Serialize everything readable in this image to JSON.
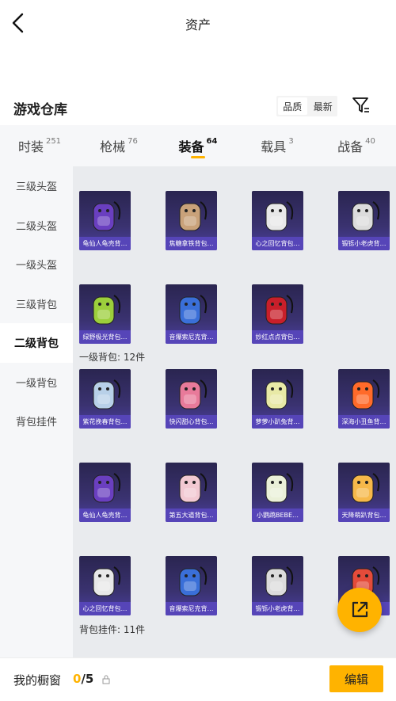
{
  "header": {
    "title": "资产"
  },
  "warehouse": {
    "title": "游戏仓库",
    "sort_options": [
      "品质",
      "最新"
    ],
    "active_sort": 0
  },
  "tabs": [
    {
      "label": "时装",
      "count": "251"
    },
    {
      "label": "枪械",
      "count": "76"
    },
    {
      "label": "装备",
      "count": "64",
      "active": true
    },
    {
      "label": "载具",
      "count": "3"
    },
    {
      "label": "战备",
      "count": "40"
    }
  ],
  "sidebar": {
    "items": [
      "三级头盔",
      "二级头盔",
      "一级头盔",
      "三级背包",
      "二级背包",
      "一级背包",
      "背包挂件"
    ],
    "active_index": 4
  },
  "sections": {
    "level1_backpack": "一级背包: 12件",
    "backpack_pendant": "背包挂件: 11件"
  },
  "items": [
    {
      "label": "龟仙人龟壳背…",
      "color": "#6a3fc0"
    },
    {
      "label": "焦糖拿铁背包…",
      "color": "#c9a27a"
    },
    {
      "label": "心之回忆背包…",
      "color": "#e8e8e8"
    },
    {
      "label": "锻铄小老虎背…",
      "color": "#dcdcdc"
    },
    {
      "label": "绿野极光背包…",
      "color": "#9ccf3c"
    },
    {
      "label": "音爆索尼克背…",
      "color": "#3a6fd8"
    },
    {
      "label": "妙红点点背包…",
      "color": "#c81f2a"
    },
    {
      "label": "紫花挽春背包…",
      "color": "#b8d0e8"
    },
    {
      "label": "快闪甜心背包…",
      "color": "#e87a9a"
    },
    {
      "label": "萝萝小趴兔背…",
      "color": "#e8e9a6"
    },
    {
      "label": "深海小丑鱼背…",
      "color": "#ff6a2a"
    },
    {
      "label": "龟仙人龟壳背…",
      "color": "#6a3fc0"
    },
    {
      "label": "第五大道背包…",
      "color": "#f2c9d2"
    },
    {
      "label": "小鹦鹉BEBE…",
      "color": "#eaf0d8"
    },
    {
      "label": "天降萌趴背包…",
      "color": "#f6b84a"
    },
    {
      "label": "心之回忆背包…",
      "color": "#e8e8e8"
    },
    {
      "label": "音爆索尼克背…",
      "color": "#3a6fd8"
    },
    {
      "label": "锻铄小老虎背…",
      "color": "#dcdcdc"
    },
    {
      "label": "",
      "color": "#e44b3a"
    }
  ],
  "showcase": {
    "label": "我的橱窗",
    "current": "0",
    "total": "/5"
  },
  "edit_label": "编辑"
}
